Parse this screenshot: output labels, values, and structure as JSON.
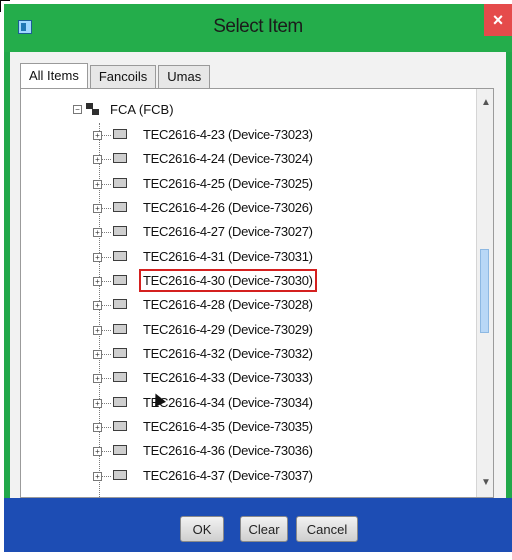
{
  "window": {
    "title": "Select Item",
    "close_icon": "×"
  },
  "tabs": [
    {
      "label": "All Items",
      "active": true
    },
    {
      "label": "Fancoils",
      "active": false
    },
    {
      "label": "Umas",
      "active": false
    }
  ],
  "tree": {
    "root_label": "FCA (FCB)",
    "items": [
      {
        "label": "TEC2616-4-23 (Device-73023)"
      },
      {
        "label": "TEC2616-4-24 (Device-73024)"
      },
      {
        "label": "TEC2616-4-25 (Device-73025)"
      },
      {
        "label": "TEC2616-4-26 (Device-73026)"
      },
      {
        "label": "TEC2616-4-27 (Device-73027)"
      },
      {
        "label": "TEC2616-4-31 (Device-73031)"
      },
      {
        "label": "TEC2616-4-30 (Device-73030)"
      },
      {
        "label": "TEC2616-4-28 (Device-73028)"
      },
      {
        "label": "TEC2616-4-29 (Device-73029)"
      },
      {
        "label": "TEC2616-4-32 (Device-73032)"
      },
      {
        "label": "TEC2616-4-33 (Device-73033)"
      },
      {
        "label": "TEC2616-4-34 (Device-73034)"
      },
      {
        "label": "TEC2616-4-35 (Device-73035)"
      },
      {
        "label": "TEC2616-4-36 (Device-73036)"
      },
      {
        "label": "TEC2616-4-37 (Device-73037)"
      }
    ],
    "highlighted_index": 6
  },
  "buttons": {
    "ok": "OK",
    "clear": "Clear",
    "cancel": "Cancel"
  },
  "colors": {
    "title_bar": "#24ad4b",
    "footer": "#1d4db4",
    "highlight": "#d4201f",
    "close": "#e54b4b"
  }
}
